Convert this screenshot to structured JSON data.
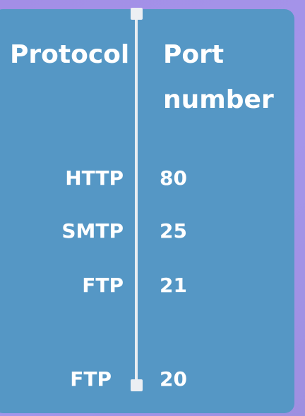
{
  "table": {
    "headers": {
      "protocol": "Protocol",
      "port_line1": "Port",
      "port_line2": "number"
    },
    "rows": [
      {
        "protocol": "HTTP",
        "port": "80"
      },
      {
        "protocol": "SMTP",
        "port": "25"
      },
      {
        "protocol": "FTP",
        "port": "21"
      },
      {
        "protocol": "FTP",
        "port": "20"
      }
    ]
  },
  "colors": {
    "background": "#a495ea",
    "card": "#5597c5",
    "divider": "#e8edf2",
    "text": "#ffffff"
  }
}
